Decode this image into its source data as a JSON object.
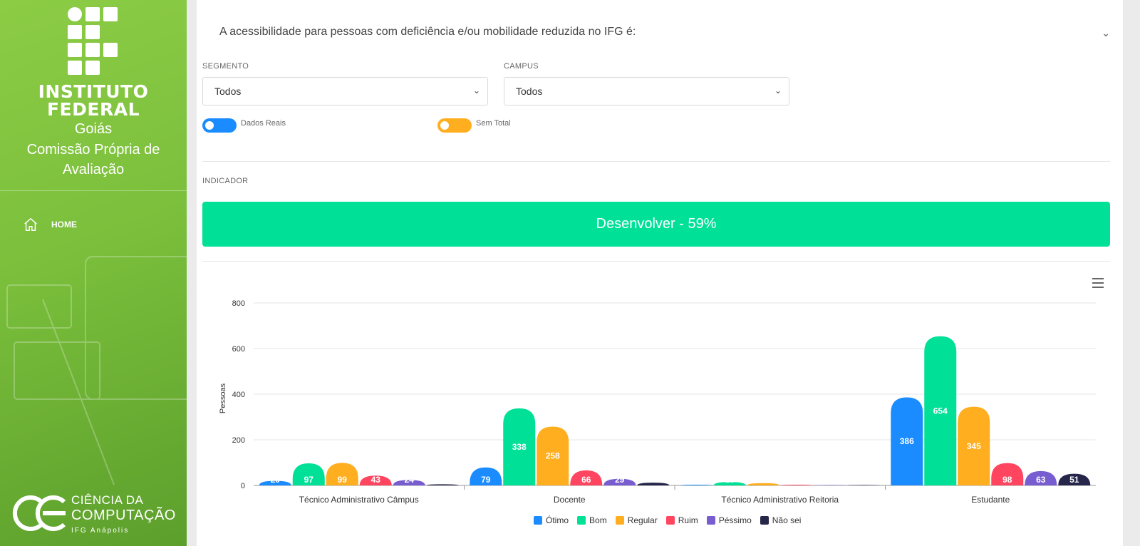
{
  "sidebar": {
    "logo_title_line1": "INSTITUTO",
    "logo_title_line2": "FEDERAL",
    "logo_state": "Goiás",
    "logo_comission": "Comissão Própria de Avaliação",
    "nav": [
      {
        "label": "HOME",
        "icon": "home-icon"
      }
    ],
    "footer_line1": "CIÊNCIA DA",
    "footer_line2": "COMPUTAÇÃO",
    "footer_line3": "IFG Anápolis"
  },
  "question": {
    "text": "A acessibilidade para pessoas com deficiência e/ou mobilidade reduzida no IFG é:",
    "icon": "chevron-down-icon"
  },
  "filters": {
    "segment_label": "SEGMENTO",
    "segment_value": "Todos",
    "campus_label": "CAMPUS",
    "campus_value": "Todos"
  },
  "toggles": {
    "real_label": "Dados Reais",
    "real_color": "#1a8cff",
    "total_label": "Sem Total",
    "total_color": "#ffae1f"
  },
  "indicator": {
    "label": "INDICADOR",
    "value": "Desenvolver - 59%",
    "color": "#00e096"
  },
  "chart_data": {
    "type": "bar",
    "categories": [
      "Técnico Administrativo Câmpus",
      "Docente",
      "Técnico Administrativo Reitoria",
      "Estudante"
    ],
    "ylabel": "Pessoas",
    "ylim": [
      0,
      800
    ],
    "yticks": [
      0,
      200,
      400,
      600,
      800
    ],
    "grid": true,
    "legend_position": "bottom",
    "series": [
      {
        "name": "Ótimo",
        "color": "#1a8cff",
        "values": [
          20,
          79,
          3,
          386
        ]
      },
      {
        "name": "Bom",
        "color": "#00e096",
        "values": [
          97,
          338,
          15,
          654
        ]
      },
      {
        "name": "Regular",
        "color": "#ffae1f",
        "values": [
          99,
          258,
          10,
          345
        ]
      },
      {
        "name": "Ruim",
        "color": "#ff4560",
        "values": [
          43,
          66,
          3,
          98
        ]
      },
      {
        "name": "Péssimo",
        "color": "#775dd0",
        "values": [
          24,
          29,
          2,
          63
        ]
      },
      {
        "name": "Não sei",
        "color": "#26264a",
        "values": [
          5,
          12,
          2,
          51
        ]
      }
    ]
  }
}
